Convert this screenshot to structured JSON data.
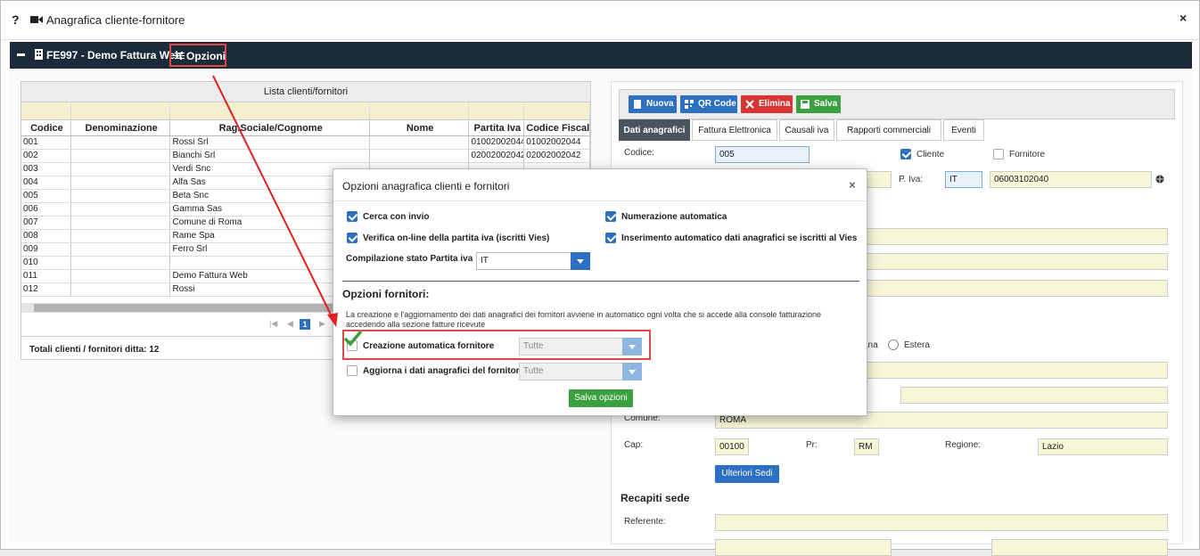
{
  "window": {
    "help": "?",
    "title": "Anagrafica cliente-fornitore",
    "close": "×"
  },
  "navbar": {
    "firm": "FE997 - Demo Fattura Web",
    "options": "Opzioni"
  },
  "grid": {
    "caption": "Lista clienti/fornitori",
    "headers": [
      "Codice",
      "Denominazione",
      "Rag.Sociale/Cognome",
      "Nome",
      "Partita Iva",
      "Codice Fiscale"
    ],
    "rows": [
      [
        "001",
        "",
        "Rossi Srl",
        "",
        "01002002044",
        "01002002044"
      ],
      [
        "002",
        "",
        "Bianchi Srl",
        "",
        "02002002042",
        "02002002042"
      ],
      [
        "003",
        "",
        "Verdi Snc",
        "",
        "",
        ""
      ],
      [
        "004",
        "",
        "Alfa Sas",
        "",
        "",
        ""
      ],
      [
        "005",
        "",
        "Beta Snc",
        "",
        "",
        ""
      ],
      [
        "006",
        "",
        "Gamma Sas",
        "",
        "",
        ""
      ],
      [
        "007",
        "",
        "Comune di Roma",
        "",
        "",
        ""
      ],
      [
        "008",
        "",
        "Rame Spa",
        "",
        "",
        ""
      ],
      [
        "009",
        "",
        "Ferro Srl",
        "",
        "",
        ""
      ],
      [
        "010",
        "",
        "",
        "",
        "",
        ""
      ],
      [
        "011",
        "",
        "Demo Fattura Web",
        "",
        "",
        ""
      ],
      [
        "012",
        "",
        "Rossi",
        "",
        "",
        ""
      ]
    ],
    "page": "1",
    "total": "Totali clienti / fornitori ditta: 12"
  },
  "form": {
    "buttons": {
      "new": "Nuova",
      "qr": "QR Code",
      "delete": "Elimina",
      "save": "Salva"
    },
    "tabs": [
      "Dati anagrafici",
      "Fattura Elettronica",
      "Causali iva",
      "Rapporti commerciali",
      "Eventi"
    ],
    "codice_label": "Codice:",
    "codice_value": "005",
    "cliente_label": "Cliente",
    "fornitore_label": "Fornitore",
    "piva_label": "P. Iva:",
    "piva_country": "IT",
    "piva_value": "06003102040",
    "nazione_partial": "ana",
    "estera_label": "Estera",
    "comune_label": "Comune:",
    "comune_value": "ROMA",
    "cap_label": "Cap:",
    "cap_value": "00100",
    "pr_label": "Pr:",
    "pr_value": "RM",
    "regione_label": "Regione:",
    "regione_value": "Lazio",
    "ulteriori_sedi": "Ulteriori Sedi",
    "recapiti_title": "Recapiti sede",
    "referente_label": "Referente:"
  },
  "modal": {
    "title": "Opzioni anagrafica clienti e fornitori",
    "close": "×",
    "cerca_invio": "Cerca con invio",
    "numerazione_auto": "Numerazione automatica",
    "verifica_online": "Verifica on-line della partita iva (iscritti Vies)",
    "inserimento_auto": "Inserimento automatico dati anagrafici se iscritti al Vies",
    "compilazione_label": "Compilazione stato Partita iva",
    "compilazione_value": "IT",
    "fornitori_title": "Opzioni fornitori:",
    "note": "La creazione e l'aggiornamento dei dati anagrafici dei fornitori avviene in automatico ogni volta che si accede alla console fatturazione accedendo alla sezione fatture ricevute",
    "creazione_label": "Creazione automatica fornitore",
    "creazione_value": "Tutte",
    "aggiorna_label": "Aggiorna i dati anagrafici del fornitore",
    "aggiorna_value": "Tutte",
    "save_button": "Salva opzioni"
  },
  "colors": {
    "navbar": "#1c2b3a",
    "accent_blue": "#2d6fc0",
    "highlight_red": "#e04848",
    "save_green": "#3aa040"
  }
}
